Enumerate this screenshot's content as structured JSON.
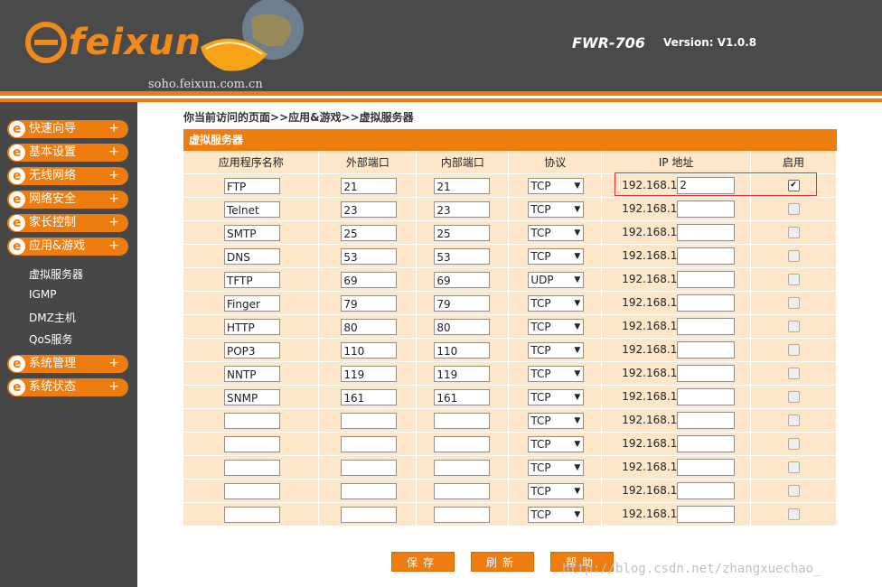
{
  "header": {
    "logo_text": "feixun",
    "domain": "soho.feixun.com.cn",
    "model": "FWR-706",
    "version": "Version: V1.0.8"
  },
  "sidebar": {
    "items": [
      {
        "label": "快速向导"
      },
      {
        "label": "基本设置"
      },
      {
        "label": "无线网络"
      },
      {
        "label": "网络安全"
      },
      {
        "label": "家长控制"
      },
      {
        "label": "应用&游戏"
      },
      {
        "label": "系统管理"
      },
      {
        "label": "系统状态"
      }
    ],
    "submenu": [
      "虚拟服务器",
      "IGMP",
      "DMZ主机",
      "QoS服务"
    ],
    "plus": "+"
  },
  "breadcrumb": "你当前访问的页面>>应用&游戏>>虚拟服务器",
  "panel": {
    "title": "虚拟服务器",
    "columns": [
      "应用程序名称",
      "外部端口",
      "内部端口",
      "协议",
      "IP 地址",
      "启用"
    ],
    "ip_prefix": "192.168.1.",
    "rows": [
      {
        "name": "FTP",
        "ext": "21",
        "int": "21",
        "proto": "TCP",
        "ip": "2",
        "enabled": true
      },
      {
        "name": "Telnet",
        "ext": "23",
        "int": "23",
        "proto": "TCP",
        "ip": "",
        "enabled": false
      },
      {
        "name": "SMTP",
        "ext": "25",
        "int": "25",
        "proto": "TCP",
        "ip": "",
        "enabled": false
      },
      {
        "name": "DNS",
        "ext": "53",
        "int": "53",
        "proto": "TCP",
        "ip": "",
        "enabled": false
      },
      {
        "name": "TFTP",
        "ext": "69",
        "int": "69",
        "proto": "UDP",
        "ip": "",
        "enabled": false
      },
      {
        "name": "Finger",
        "ext": "79",
        "int": "79",
        "proto": "TCP",
        "ip": "",
        "enabled": false
      },
      {
        "name": "HTTP",
        "ext": "80",
        "int": "80",
        "proto": "TCP",
        "ip": "",
        "enabled": false
      },
      {
        "name": "POP3",
        "ext": "110",
        "int": "110",
        "proto": "TCP",
        "ip": "",
        "enabled": false
      },
      {
        "name": "NNTP",
        "ext": "119",
        "int": "119",
        "proto": "TCP",
        "ip": "",
        "enabled": false
      },
      {
        "name": "SNMP",
        "ext": "161",
        "int": "161",
        "proto": "TCP",
        "ip": "",
        "enabled": false
      },
      {
        "name": "",
        "ext": "",
        "int": "",
        "proto": "TCP",
        "ip": "",
        "enabled": false
      },
      {
        "name": "",
        "ext": "",
        "int": "",
        "proto": "TCP",
        "ip": "",
        "enabled": false
      },
      {
        "name": "",
        "ext": "",
        "int": "",
        "proto": "TCP",
        "ip": "",
        "enabled": false
      },
      {
        "name": "",
        "ext": "",
        "int": "",
        "proto": "TCP",
        "ip": "",
        "enabled": false
      },
      {
        "name": "",
        "ext": "",
        "int": "",
        "proto": "TCP",
        "ip": "",
        "enabled": false
      }
    ]
  },
  "buttons": {
    "save": "保存",
    "refresh": "刷新",
    "help": "帮助"
  },
  "watermark": "http://blog.csdn.net/zhangxuechao_",
  "colors": {
    "accent": "#ee7d10",
    "panel_bg": "#fde7c8",
    "header_bg": "#4a4a4a",
    "sidebar_bg": "#474747",
    "highlight": "#e03030"
  },
  "icons": {
    "checkbox_checked": "check-icon",
    "dropdown": "chevron-down-icon"
  }
}
